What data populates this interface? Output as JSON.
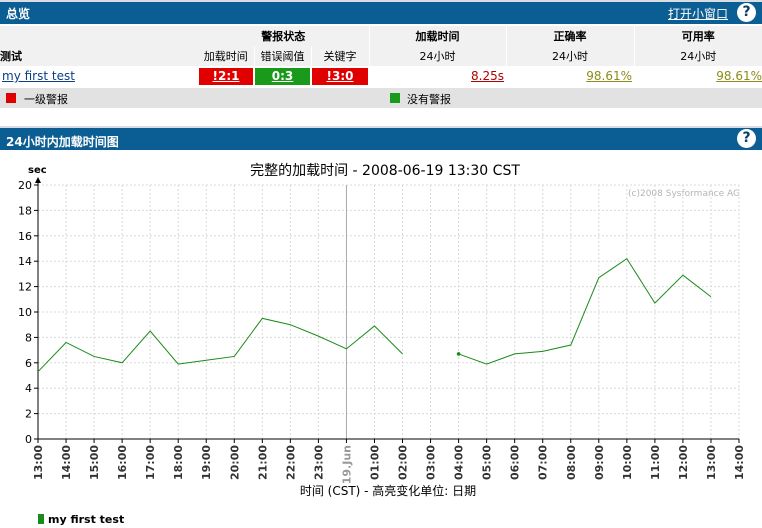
{
  "overview": {
    "title": "总览",
    "popup_link": "打开小窗口",
    "help": "?",
    "col_test": "测试",
    "col_alert_status": "警报状态",
    "col_load_time": "加载时间",
    "col_accuracy": "正确率",
    "col_availability": "可用率",
    "sub_load": "加载时间",
    "sub_error": "错误阈值",
    "sub_keyword": "关键字",
    "sub_24h_1": "24小时",
    "sub_24h_2": "24小时",
    "sub_24h_3": "24小时",
    "row": {
      "name": "my first test",
      "status_load": "!2:1",
      "status_error": "0:3",
      "status_keyword": "!3:0",
      "load_time": "8.25s",
      "accuracy": "98.61%",
      "availability": "98.61%"
    },
    "legend_red": "一级警报",
    "legend_green": "没有警报",
    "colors": {
      "header": "#0b5e93",
      "red": "#e00000",
      "green": "#1a9a1a",
      "link_olive": "#8b8b1a",
      "link_red": "#b00000"
    }
  },
  "chart_section": {
    "title": "24小时内加载时间图",
    "help": "?"
  },
  "chart_data": {
    "type": "line",
    "title": "完整的加载时间 - 2008-06-19 13:30 CST",
    "ylabel": "sec",
    "xlabel": "时间 (CST) - 高亮变化单位: 日期",
    "watermark": "(c)2008 Sysformance AG",
    "ylim": [
      0,
      20
    ],
    "yticks": [
      0,
      2,
      4,
      6,
      8,
      10,
      12,
      14,
      16,
      18,
      20
    ],
    "categories": [
      "13:00",
      "14:00",
      "15:00",
      "16:00",
      "17:00",
      "18:00",
      "19:00",
      "20:00",
      "21:00",
      "22:00",
      "23:00",
      "19.Jun",
      "01:00",
      "02:00",
      "03:00",
      "04:00",
      "05:00",
      "06:00",
      "07:00",
      "08:00",
      "09:00",
      "10:00",
      "11:00",
      "12:00",
      "13:00",
      "14:00"
    ],
    "highlight_category": "19.Jun",
    "series": [
      {
        "name": "my first test",
        "color": "#1a8a1a",
        "values": [
          5.3,
          7.6,
          6.5,
          6.0,
          8.5,
          5.9,
          6.2,
          6.5,
          9.5,
          9.0,
          8.1,
          7.1,
          8.9,
          6.7,
          null,
          6.7,
          5.9,
          6.7,
          6.9,
          7.4,
          12.7,
          14.2,
          10.7,
          12.9,
          11.2,
          null
        ]
      }
    ],
    "legend": [
      "my first test"
    ]
  }
}
